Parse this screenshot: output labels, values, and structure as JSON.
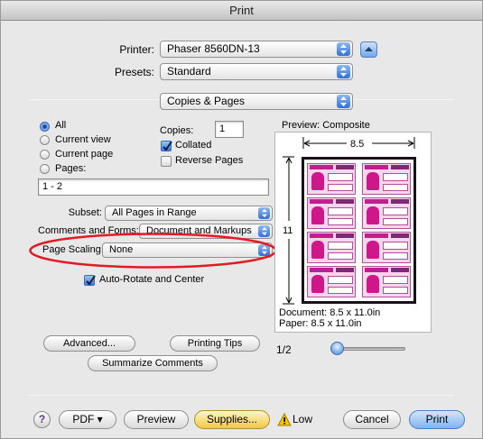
{
  "window": {
    "title": "Print"
  },
  "printer": {
    "label": "Printer:",
    "value": "Phaser 8560DN-13"
  },
  "presets": {
    "label": "Presets:",
    "value": "Standard"
  },
  "panel": {
    "value": "Copies & Pages"
  },
  "pages": {
    "options": [
      {
        "label": "All",
        "selected": true
      },
      {
        "label": "Current view",
        "selected": false
      },
      {
        "label": "Current page",
        "selected": false
      },
      {
        "label": "Pages:",
        "selected": false
      }
    ],
    "range_value": "1 - 2"
  },
  "copies": {
    "label": "Copies:",
    "value": "1",
    "collated": {
      "label": "Collated",
      "checked": true
    },
    "reverse": {
      "label": "Reverse Pages",
      "checked": false
    }
  },
  "subset": {
    "label": "Subset:",
    "value": "All Pages in Range"
  },
  "comments_forms": {
    "label": "Comments and Forms:",
    "value": "Document and Markups"
  },
  "page_scaling": {
    "label": "Page Scaling:",
    "value": "None"
  },
  "auto_rotate": {
    "label": "Auto-Rotate and Center",
    "checked": true
  },
  "preview": {
    "title": "Preview: Composite",
    "width_label": "8.5",
    "height_label": "11",
    "document_size": "Document: 8.5 x 11.0in",
    "paper_size": "Paper: 8.5 x 11.0in",
    "page_indicator": "1/2",
    "zoom_level": 0.0
  },
  "buttons": {
    "advanced": "Advanced...",
    "printing_tips": "Printing Tips",
    "summarize": "Summarize Comments",
    "help": "?",
    "pdf": "PDF ▾",
    "preview": "Preview",
    "supplies": "Supplies...",
    "cancel": "Cancel",
    "print": "Print"
  },
  "supply_status": {
    "text": "Low"
  },
  "colors": {
    "accent_blue": "#3b7ddb",
    "supplies_yellow": "#f1c74a",
    "warning_yellow": "#f4c400",
    "highlight_red": "#e01b24",
    "preview_pink": "#d0178a"
  }
}
